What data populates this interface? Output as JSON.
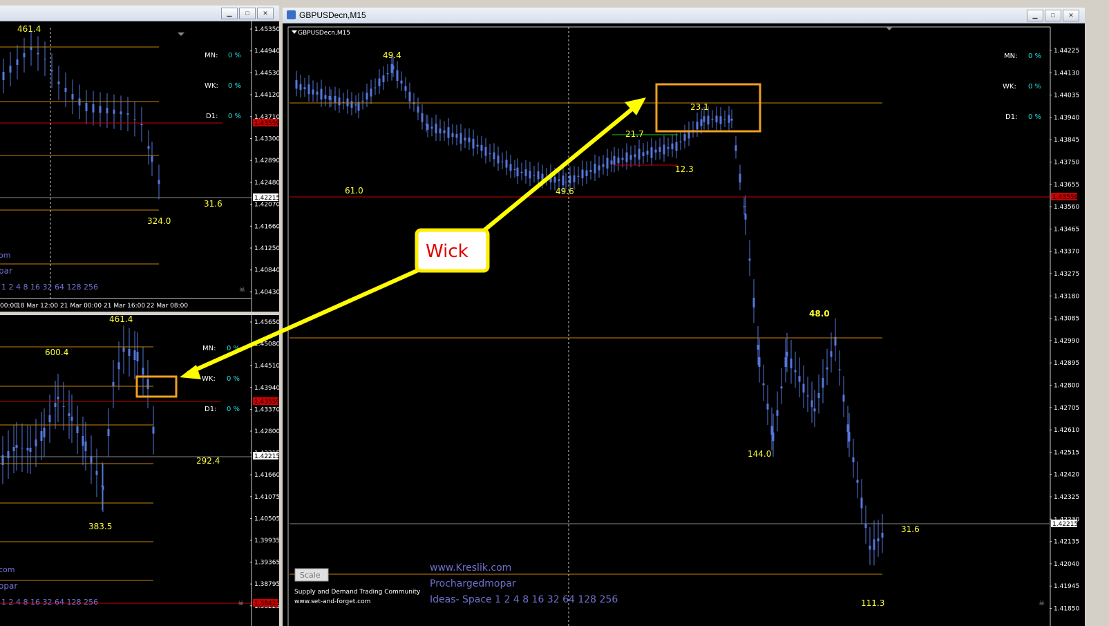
{
  "main_window": {
    "title": "GBPUSDecn,M15",
    "chart_label": "GBPUSDecn,M15",
    "price_axis": [
      "1.44225",
      "1.44130",
      "1.44035",
      "1.43940",
      "1.43845",
      "1.43750",
      "1.43655",
      "1.43560",
      "1.43465",
      "1.43370",
      "1.43275",
      "1.43180",
      "1.43085",
      "1.42990",
      "1.42895",
      "1.42800",
      "1.42705",
      "1.42610",
      "1.42515",
      "1.42420",
      "1.42325",
      "1.42230",
      "1.42135",
      "1.42040",
      "1.41945",
      "1.41850"
    ],
    "current_price_tag": "1.42215",
    "red_price_tag": "1.43559",
    "labels": {
      "l494": "49.4",
      "l610": "61.0",
      "l496": "49.6",
      "l217": "21.7",
      "l231": "23.1",
      "l123": "12.3",
      "l480": "48.0",
      "l1440": "144.0",
      "l316": "31.6",
      "l1113": "111.3"
    },
    "info": [
      {
        "k": "MN:",
        "v": "0 %"
      },
      {
        "k": "WK:",
        "v": "0 %"
      },
      {
        "k": "D1:",
        "v": "0 %"
      }
    ],
    "scale_button": "Scale",
    "footer_small_1": "Supply and Demand Trading Community",
    "footer_small_2": "www.set-and-forget.com",
    "footer_url": "www.Kreslik.com",
    "footer_name": "Prochargedmopar",
    "footer_ideas": "Ideas- Space 1 2 4 8 16 32 64 128 256"
  },
  "top_left_window": {
    "price_axis": [
      "1.45350",
      "1.44940",
      "1.44530",
      "1.44120",
      "1.43710",
      "1.43300",
      "1.42890",
      "1.42480",
      "1.42070",
      "1.41660",
      "1.41250",
      "1.40840",
      "1.40430"
    ],
    "current_price_tag": "1.42215",
    "red_price_tag": "1.43559",
    "labels": {
      "top": "461.4",
      "l316": "31.6",
      "l3240": "324.0"
    },
    "info": [
      {
        "k": "MN:",
        "v": "0 %"
      },
      {
        "k": "WK:",
        "v": "0 %"
      },
      {
        "k": "D1:",
        "v": "0 %"
      }
    ],
    "footer_com": "om",
    "footer_par": "par",
    "footer_ideas": "1 2 4 8 16 32 64 128 256",
    "time_axis": [
      "00:00",
      "18 Mar 12:00",
      "21 Mar 00:00",
      "21 Mar 16:00",
      "22 Mar 08:00"
    ]
  },
  "bottom_left_window": {
    "price_axis": [
      "1.45650",
      "1.45080",
      "1.44510",
      "1.43940",
      "1.43370",
      "1.42800",
      "1.42215",
      "1.41660",
      "1.41075",
      "1.40505",
      "1.39935",
      "1.39365",
      "1.38795",
      "1.38225"
    ],
    "current_price_tag": "1.42215",
    "red_price_tag": "1.43559",
    "bottom_red_tag": "1.38421",
    "labels": {
      "top": "461.4",
      "l6004": "600.4",
      "l2924": "292.4",
      "l3835": "383.5"
    },
    "info": [
      {
        "k": "MN:",
        "v": "0 %"
      },
      {
        "k": "WK:",
        "v": "0 %"
      },
      {
        "k": "D1:",
        "v": "0 %"
      }
    ],
    "footer_com": "com",
    "footer_par": "opar",
    "footer_ideas": "1 2 4 8 16 32 64 128 256"
  },
  "annotation": {
    "label": "Wick"
  },
  "colors": {
    "background": "#000000",
    "candle": "#5577dd",
    "level_orange": "#c8860a",
    "level_red": "#cc0000",
    "label_yellow": "#ffff33",
    "info_cyan": "#22dddd",
    "arrow": "#ffff00",
    "box": "#f0a020",
    "annotation_text": "#e00000",
    "footer_purple": "#7070d0"
  }
}
